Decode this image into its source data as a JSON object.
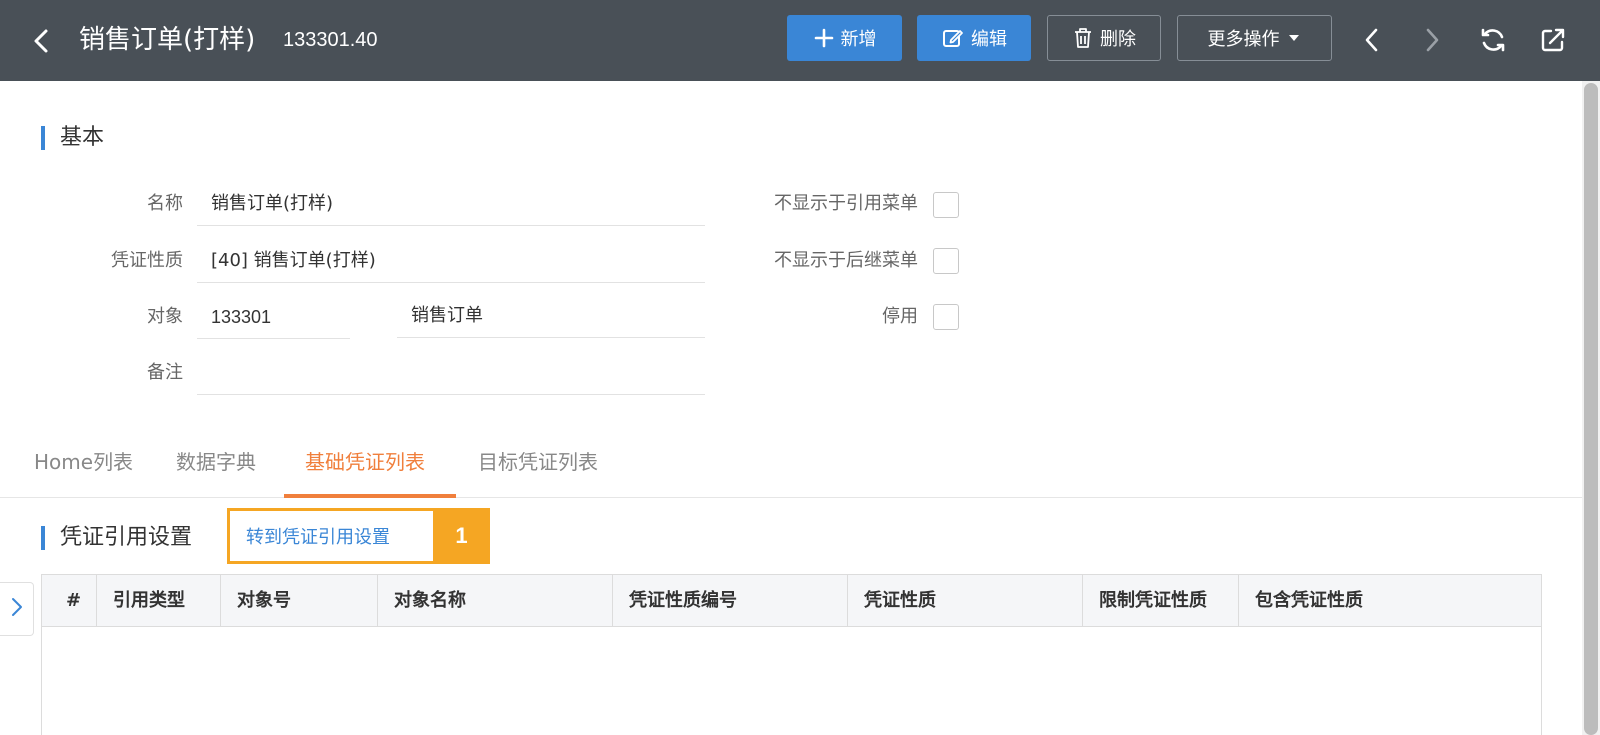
{
  "header": {
    "title": "销售订单(打样)",
    "code": "133301.40",
    "buttons": {
      "add": "新增",
      "edit": "编辑",
      "delete": "删除",
      "more": "更多操作"
    }
  },
  "basic_section": {
    "title": "基本",
    "fields": {
      "name_label": "名称",
      "name_value": "销售订单(打样)",
      "voucher_nature_label": "凭证性质",
      "voucher_nature_value": "[40] 销售订单(打样)",
      "object_label": "对象",
      "object_code": "133301",
      "object_name": "销售订单",
      "remark_label": "备注",
      "remark_value": ""
    },
    "checkboxes": {
      "hide_ref_menu": "不显示于引用菜单",
      "hide_next_menu": "不显示于后继菜单",
      "disabled": "停用"
    }
  },
  "tabs": [
    "Home列表",
    "数据字典",
    "基础凭证列表",
    "目标凭证列表"
  ],
  "active_tab": "基础凭证列表",
  "ref_section": {
    "title": "凭证引用设置",
    "link": "转到凭证引用设置",
    "badge": "1"
  },
  "table": {
    "columns": [
      "#",
      "引用类型",
      "对象号",
      "对象名称",
      "凭证性质编号",
      "凭证性质",
      "限制凭证性质",
      "包含凭证性质"
    ],
    "rows": []
  },
  "colors": {
    "topbar": "#495057",
    "primary": "#3a86d6",
    "active_tab": "#f07f3c",
    "highlight": "#f5a623"
  }
}
